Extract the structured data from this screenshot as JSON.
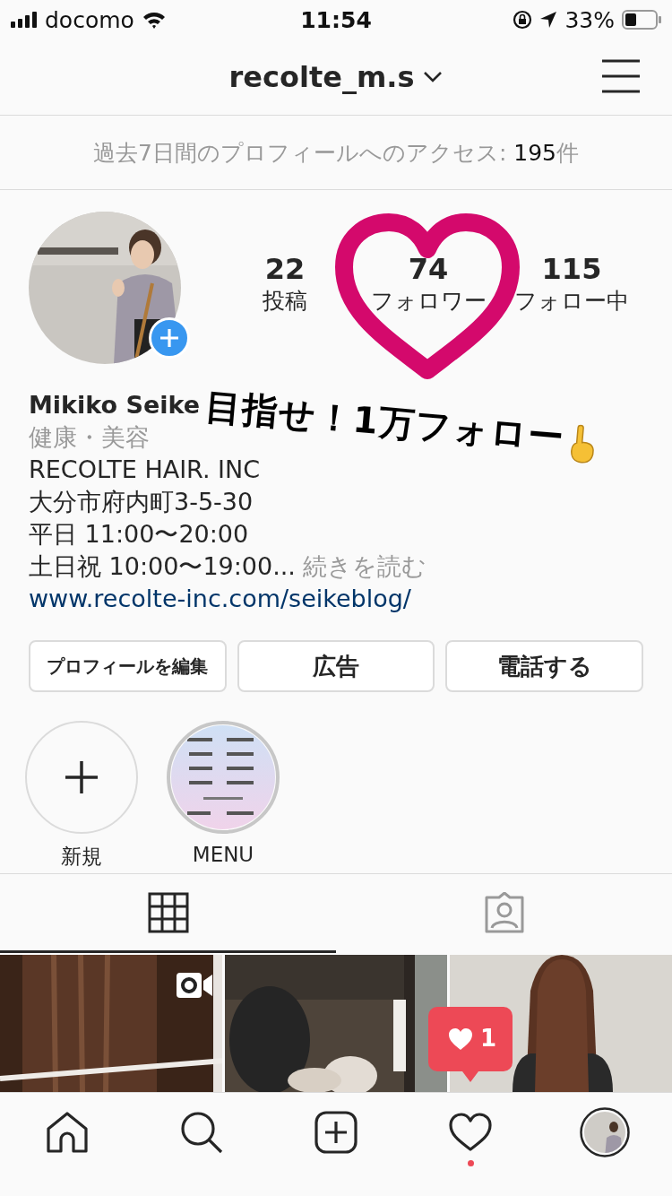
{
  "status_bar": {
    "carrier": "docomo",
    "time": "11:54",
    "battery": "33%"
  },
  "header": {
    "username": "recolte_m.s"
  },
  "access_banner": {
    "text": "過去7日間のプロフィールへのアクセス: ",
    "count": "195",
    "suffix": "件"
  },
  "stats": [
    {
      "value": "22",
      "label": "投稿"
    },
    {
      "value": "74",
      "label": "フォロワー"
    },
    {
      "value": "115",
      "label": "フォロー中"
    }
  ],
  "overlay": {
    "text": "目指せ！1万フォロー"
  },
  "profile": {
    "name": "Mikiko Seike",
    "category": "健康・美容",
    "bio_lines": [
      "RECOLTE HAIR. INC",
      "大分市府内町3-5-30",
      "平日 11:00〜20:00",
      "土日祝 10:00〜19:00..."
    ],
    "more_link": "続きを読む",
    "website": "www.recolte-inc.com/seikeblog/"
  },
  "buttons": [
    "プロフィールを編集",
    "広告",
    "電話する"
  ],
  "highlights": [
    {
      "kind": "new",
      "label": "新規"
    },
    {
      "kind": "picture",
      "label": "MENU"
    }
  ],
  "tabs": [
    {
      "kind": "grid",
      "selected": true
    },
    {
      "kind": "tagged",
      "selected": false
    }
  ],
  "posts": [
    {
      "kind": "hair",
      "video": true
    },
    {
      "kind": "dogs",
      "video": false
    },
    {
      "kind": "long_hair",
      "video": false
    }
  ],
  "notification": {
    "count": "1"
  },
  "bottom_nav": [
    {
      "kind": "home",
      "dot": false
    },
    {
      "kind": "search",
      "dot": false
    },
    {
      "kind": "new_post",
      "dot": false
    },
    {
      "kind": "activity",
      "dot": true
    },
    {
      "kind": "profile",
      "dot": false
    }
  ]
}
